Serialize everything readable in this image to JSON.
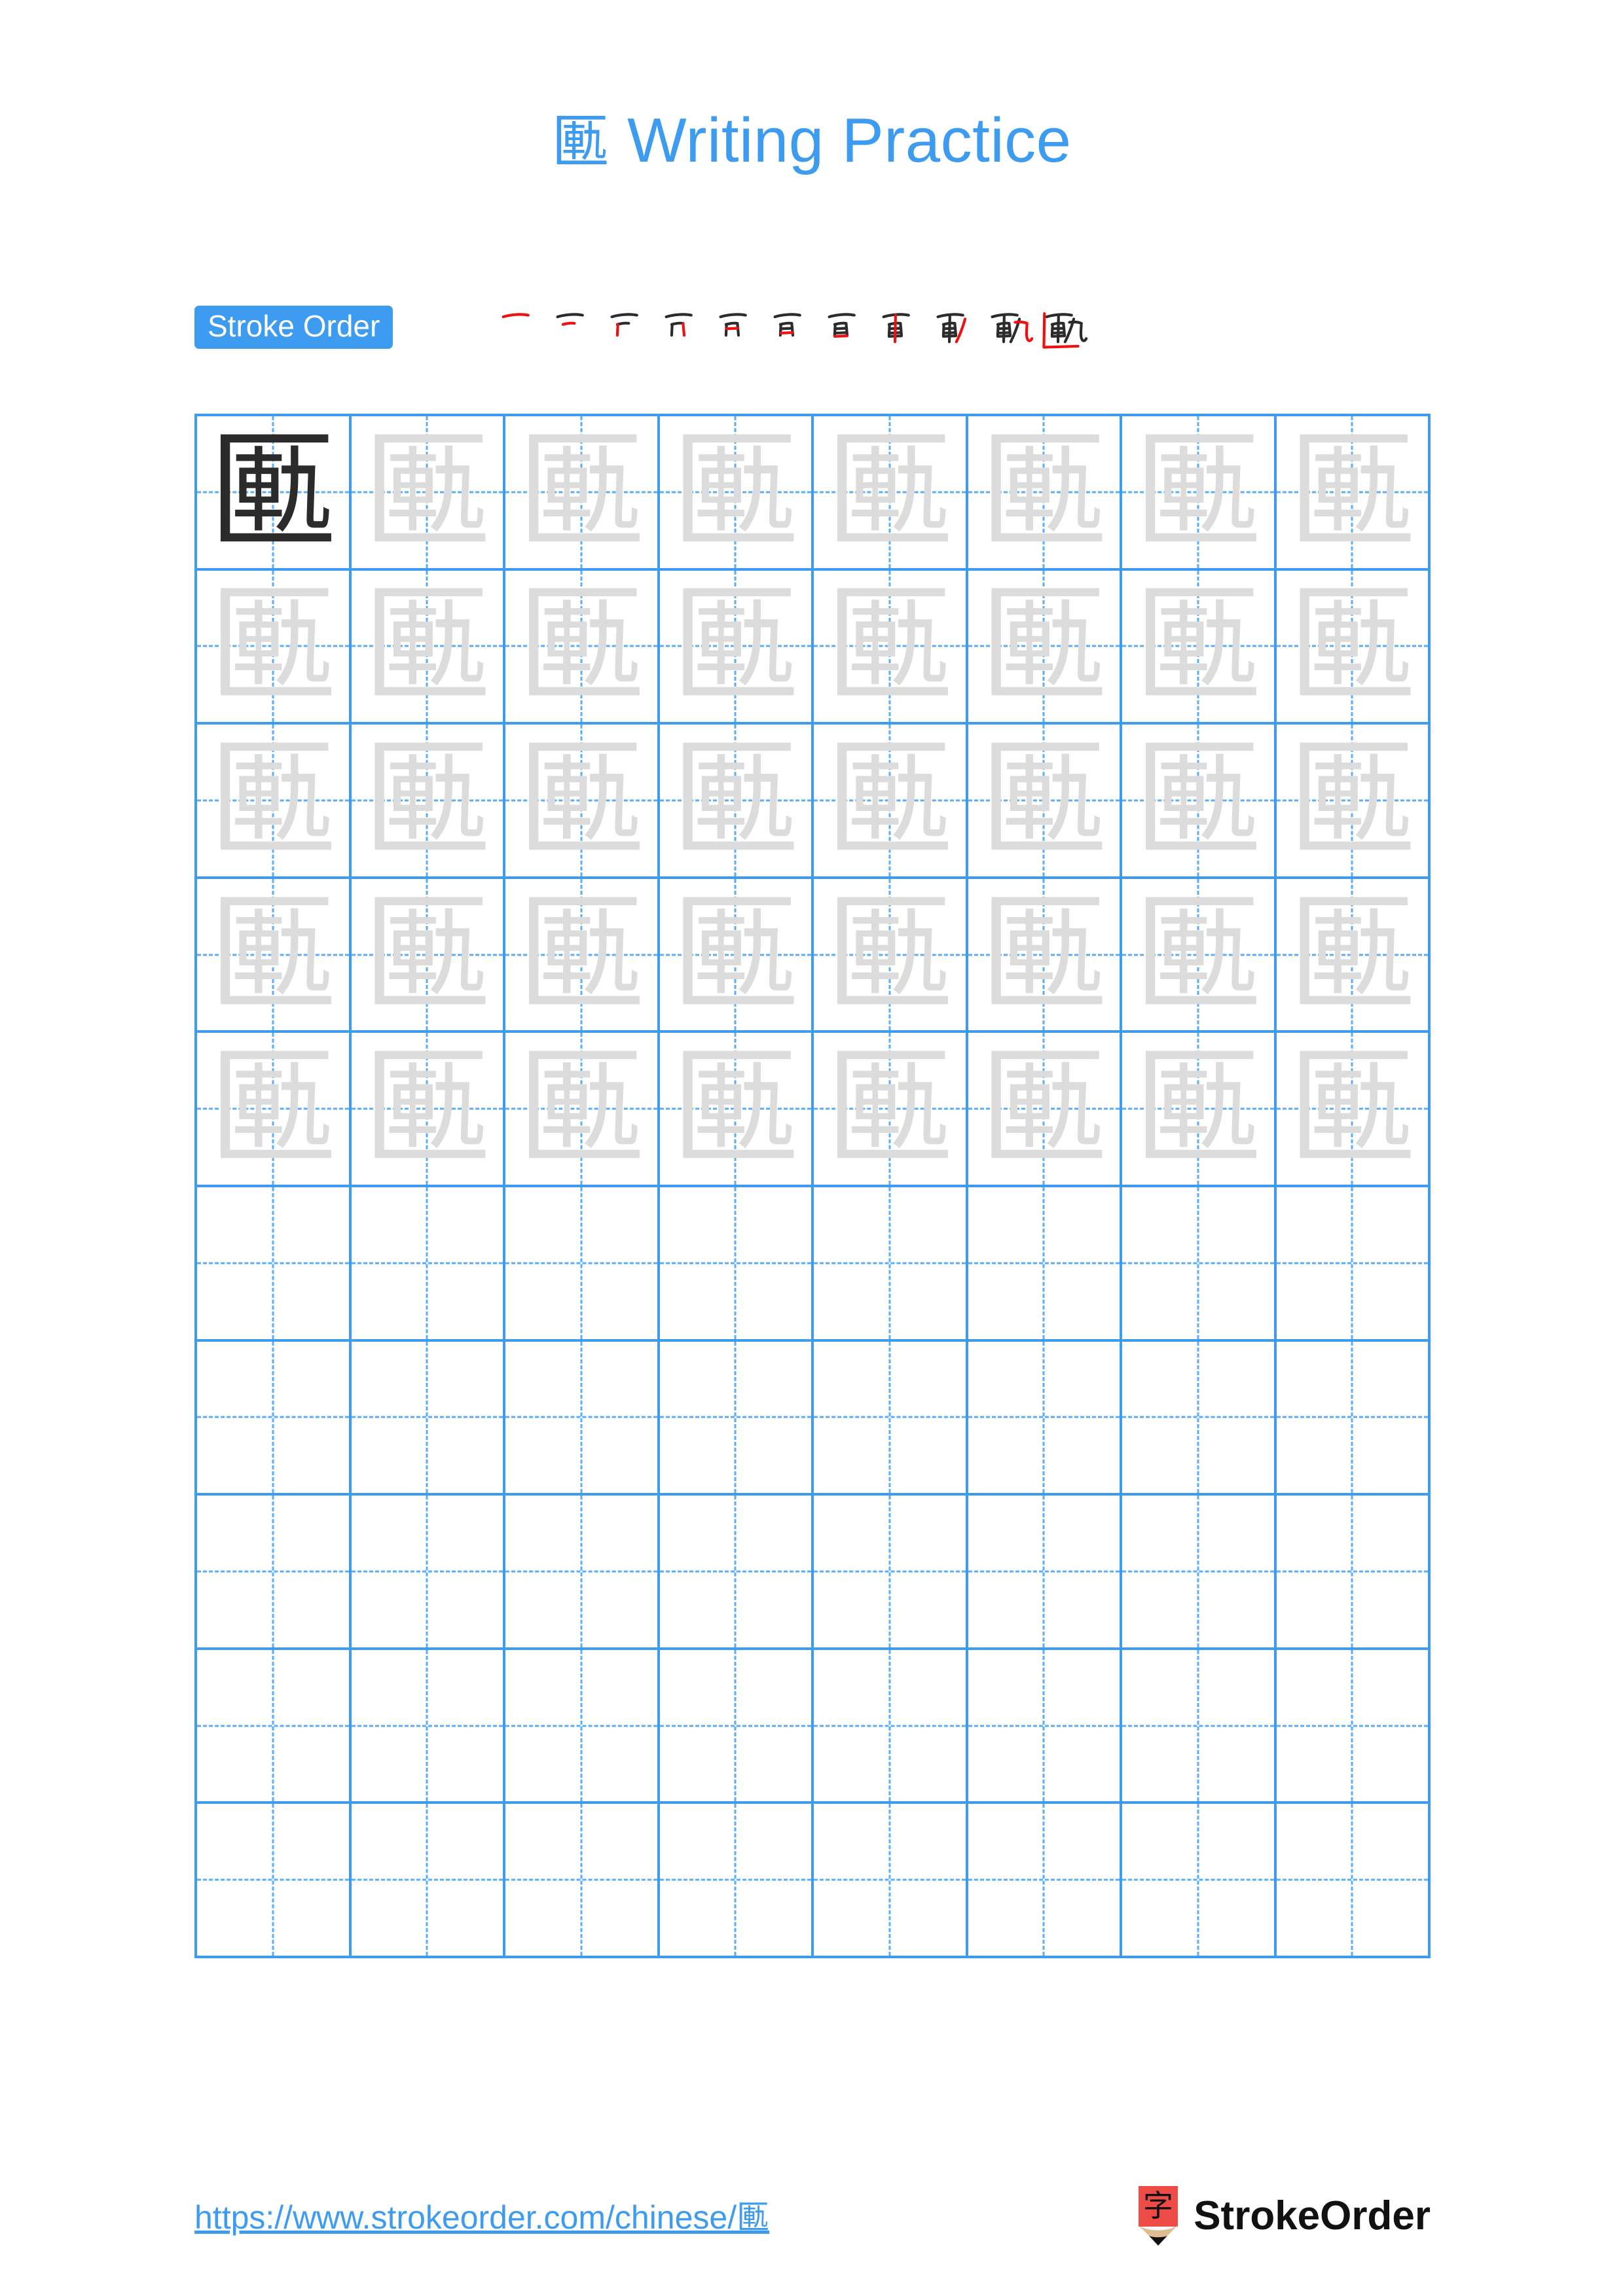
{
  "character": "匭",
  "header": {
    "title_prefix": "匭",
    "title_text": " Writing Practice"
  },
  "stroke_order": {
    "badge_label": "Stroke Order",
    "total_strokes": 11,
    "colors": {
      "completed_stroke": "#2b2b2b",
      "current_stroke": "#ee1111"
    },
    "frames": [
      {
        "index": 1,
        "new_stroke": "héng (horizontal top)"
      },
      {
        "index": 2,
        "new_stroke": "héng (short horizontal)"
      },
      {
        "index": 3,
        "new_stroke": "shù (left vertical)"
      },
      {
        "index": 4,
        "new_stroke": "héngzhé (turn right)"
      },
      {
        "index": 5,
        "new_stroke": "héng (inner horizontal)"
      },
      {
        "index": 6,
        "new_stroke": "héng (inner horizontal 2)"
      },
      {
        "index": 7,
        "new_stroke": "héng (base horizontal)"
      },
      {
        "index": 8,
        "new_stroke": "shù (long center vertical)"
      },
      {
        "index": 9,
        "new_stroke": "piě (left falling of 九)"
      },
      {
        "index": 10,
        "new_stroke": "héng-zhé-wān-gōu (hook of 九)"
      },
      {
        "index": 11,
        "new_stroke": "shù-zhé (匚 enclosure)"
      }
    ]
  },
  "grid": {
    "columns": 8,
    "rows": 10,
    "filled_rows": 5,
    "solid_line_color": "#3D9BF0",
    "dashed_line_color": "#5AAEF7",
    "model_char_color": "#2b2b2b",
    "trace_char_color": "#dcdcdc",
    "cells": [
      [
        {
          "char": "匭",
          "style": "dark"
        },
        {
          "char": "匭",
          "style": "trace"
        },
        {
          "char": "匭",
          "style": "trace"
        },
        {
          "char": "匭",
          "style": "trace"
        },
        {
          "char": "匭",
          "style": "trace"
        },
        {
          "char": "匭",
          "style": "trace"
        },
        {
          "char": "匭",
          "style": "trace"
        },
        {
          "char": "匭",
          "style": "trace"
        }
      ],
      [
        {
          "char": "匭",
          "style": "trace"
        },
        {
          "char": "匭",
          "style": "trace"
        },
        {
          "char": "匭",
          "style": "trace"
        },
        {
          "char": "匭",
          "style": "trace"
        },
        {
          "char": "匭",
          "style": "trace"
        },
        {
          "char": "匭",
          "style": "trace"
        },
        {
          "char": "匭",
          "style": "trace"
        },
        {
          "char": "匭",
          "style": "trace"
        }
      ],
      [
        {
          "char": "匭",
          "style": "trace"
        },
        {
          "char": "匭",
          "style": "trace"
        },
        {
          "char": "匭",
          "style": "trace"
        },
        {
          "char": "匭",
          "style": "trace"
        },
        {
          "char": "匭",
          "style": "trace"
        },
        {
          "char": "匭",
          "style": "trace"
        },
        {
          "char": "匭",
          "style": "trace"
        },
        {
          "char": "匭",
          "style": "trace"
        }
      ],
      [
        {
          "char": "匭",
          "style": "trace"
        },
        {
          "char": "匭",
          "style": "trace"
        },
        {
          "char": "匭",
          "style": "trace"
        },
        {
          "char": "匭",
          "style": "trace"
        },
        {
          "char": "匭",
          "style": "trace"
        },
        {
          "char": "匭",
          "style": "trace"
        },
        {
          "char": "匭",
          "style": "trace"
        },
        {
          "char": "匭",
          "style": "trace"
        }
      ],
      [
        {
          "char": "匭",
          "style": "trace"
        },
        {
          "char": "匭",
          "style": "trace"
        },
        {
          "char": "匭",
          "style": "trace"
        },
        {
          "char": "匭",
          "style": "trace"
        },
        {
          "char": "匭",
          "style": "trace"
        },
        {
          "char": "匭",
          "style": "trace"
        },
        {
          "char": "匭",
          "style": "trace"
        },
        {
          "char": "匭",
          "style": "trace"
        }
      ],
      [
        {
          "char": "",
          "style": "empty"
        },
        {
          "char": "",
          "style": "empty"
        },
        {
          "char": "",
          "style": "empty"
        },
        {
          "char": "",
          "style": "empty"
        },
        {
          "char": "",
          "style": "empty"
        },
        {
          "char": "",
          "style": "empty"
        },
        {
          "char": "",
          "style": "empty"
        },
        {
          "char": "",
          "style": "empty"
        }
      ],
      [
        {
          "char": "",
          "style": "empty"
        },
        {
          "char": "",
          "style": "empty"
        },
        {
          "char": "",
          "style": "empty"
        },
        {
          "char": "",
          "style": "empty"
        },
        {
          "char": "",
          "style": "empty"
        },
        {
          "char": "",
          "style": "empty"
        },
        {
          "char": "",
          "style": "empty"
        },
        {
          "char": "",
          "style": "empty"
        }
      ],
      [
        {
          "char": "",
          "style": "empty"
        },
        {
          "char": "",
          "style": "empty"
        },
        {
          "char": "",
          "style": "empty"
        },
        {
          "char": "",
          "style": "empty"
        },
        {
          "char": "",
          "style": "empty"
        },
        {
          "char": "",
          "style": "empty"
        },
        {
          "char": "",
          "style": "empty"
        },
        {
          "char": "",
          "style": "empty"
        }
      ],
      [
        {
          "char": "",
          "style": "empty"
        },
        {
          "char": "",
          "style": "empty"
        },
        {
          "char": "",
          "style": "empty"
        },
        {
          "char": "",
          "style": "empty"
        },
        {
          "char": "",
          "style": "empty"
        },
        {
          "char": "",
          "style": "empty"
        },
        {
          "char": "",
          "style": "empty"
        },
        {
          "char": "",
          "style": "empty"
        }
      ],
      [
        {
          "char": "",
          "style": "empty"
        },
        {
          "char": "",
          "style": "empty"
        },
        {
          "char": "",
          "style": "empty"
        },
        {
          "char": "",
          "style": "empty"
        },
        {
          "char": "",
          "style": "empty"
        },
        {
          "char": "",
          "style": "empty"
        },
        {
          "char": "",
          "style": "empty"
        },
        {
          "char": "",
          "style": "empty"
        }
      ]
    ]
  },
  "footer": {
    "url": "https://www.strokeorder.com/chinese/匭",
    "brand_name": "StrokeOrder",
    "logo_char": "字",
    "logo_body_color": "#EE4B47",
    "logo_wood_color": "#E0BC92",
    "logo_tip_color": "#111111"
  }
}
